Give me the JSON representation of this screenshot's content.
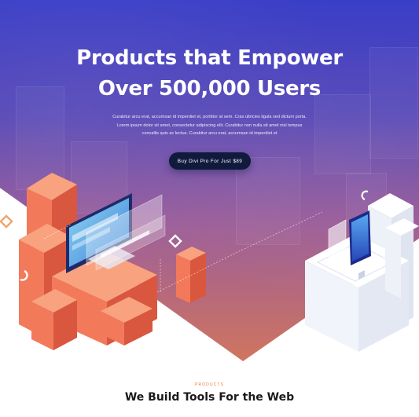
{
  "hero": {
    "title_line1": "Products that Empower",
    "title_line2": "Over 500,000 Users",
    "paragraph_line1": "Curabitur arcu erat, accumsan id imperdiet et, porttitor at sem. Cras ultricies ligula sed dictum porta.",
    "paragraph_line2": "Lorem ipsum dolor sit amet, consectetur adipiscing elit. Curabitur non nulla sit amet nisl tempus",
    "paragraph_line3": "convallis quis ac lectus. Curabitur arcu erat, accumsan id imperdiet et",
    "cta_label": "Buy Divi Pro For Just $89"
  },
  "section": {
    "label": "PRODUCTS",
    "title": "We Build Tools For the Web"
  },
  "colors": {
    "gradient_top": "#3a3fc7",
    "gradient_bottom": "#d0755f",
    "cta_bg": "#0f1a3c",
    "accent_orange": "#f07b45",
    "block_orange": "#f27a5a"
  },
  "icons": {
    "diamond_left": "diamond-outline-icon",
    "diamond_center": "diamond-outline-icon",
    "ring_left": "ring-icon",
    "ring_right": "ring-icon"
  }
}
